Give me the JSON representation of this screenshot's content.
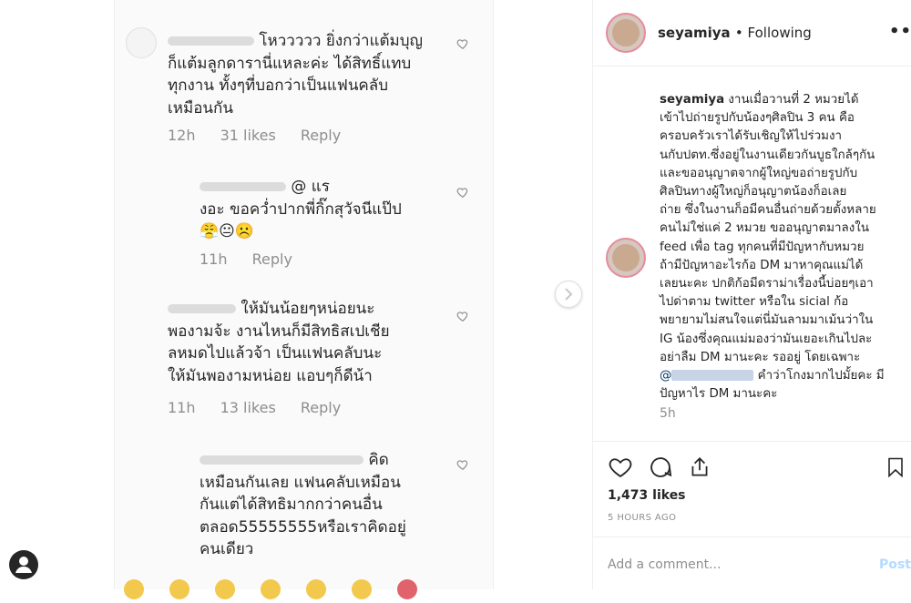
{
  "comments": [
    {
      "lines": [
        "โหววววว ยิ่งกว่าแต้มบุญ",
        "ก็แต้มลูกดารานี่แหละค่ะ ได้สิทธิ์แทบ",
        "ทุกงาน ทั้งๆที่บอกว่าเป็นแฟนคลับ",
        "เหมือนกัน"
      ],
      "time": "12h",
      "likes": "31 likes",
      "reply": "Reply"
    },
    {
      "lines": [
        "@ แร",
        "งอะ ขอคว่ำปากพี่กิ๊กสุวัจนีแป๊ป",
        "😤😐☹️"
      ],
      "time": "11h",
      "likes": "",
      "reply": "Reply"
    },
    {
      "lines": [
        "ให้มันน้อยๆหน่อยนะ",
        "พองามจ้ะ งานไหนก็มีสิทธิสเปเชีย",
        "ลหมดไปแล้วจ้า เป็นแฟนคลับนะ",
        "ให้มันพองามหน่อย แอบๆก็ดีน้า"
      ],
      "time": "11h",
      "likes": "13 likes",
      "reply": "Reply"
    },
    {
      "lines": [
        "คิด",
        "เหมือนกันเลย แฟนคลับเหมือน",
        "กันแต่ได้สิทธิมากกว่าคนอื่น",
        "ตลอด55555555หรือเราคิดอยู่",
        "คนเดียว"
      ]
    }
  ],
  "post": {
    "username": "seyamiya",
    "following": "• Following",
    "more": "•••",
    "caption_user": "seyamiya",
    "caption_lines": [
      "งานเมื่อวานที่ 2 หมวยได้",
      "เข้าไปถ่ายรูปกับน้องๆศิลปิน 3 คน คือ",
      "ครอบครัวเราได้รับเชิญให้ไปร่วมงา",
      "นกับปตท.ซึ่งอยู่ในงานเดียวกันบูธใกล้ๆกัน",
      "และขออนุญาตจากผู้ใหญ่ขอถ่ายรูปกับ",
      "ศิลปินทางผู้ใหญ่ก็อนุญาตน้องก็อเลย",
      "ถ่าย ซึ่งในงานก็อมีคนอื่นถ่ายด้วยตั้งหลาย",
      "คนไม่ใช่แค่ 2 หมวย ขออนุญาตมาลงใน",
      "feed เพื่อ tag ทุกคนที่มีปัญหากับหมวย",
      "ถ้ามีปัญหาอะไรก้อ DM มาหาคุณแม่ได้",
      "เลยนะคะ ปกติก้อมีดราม่าเรื่องนี้บ่อยๆเอา",
      "ไปด่าตาม twitter หรือใน sicial ก้อ",
      "พยายามไม่สนใจแต่นี่มันลามมาเม้นว่าใน",
      "IG น้องซึ่งคุณแม่มองว่ามันเยอะเกินไปละ",
      "อย่าลืม DM มานะคะ รออยู่ โดยเฉพาะ"
    ],
    "mention_prefix": "@",
    "caption_tail_1": " คำว่าโกงมากไปมั้ยคะ มี",
    "caption_tail_2": "ปัญหาไร DM มานะคะ",
    "caption_time": "5h",
    "likes": "1,473 likes",
    "ago": "5 HOURS AGO",
    "add_comment_placeholder": "Add a comment...",
    "post_button": "Post"
  }
}
